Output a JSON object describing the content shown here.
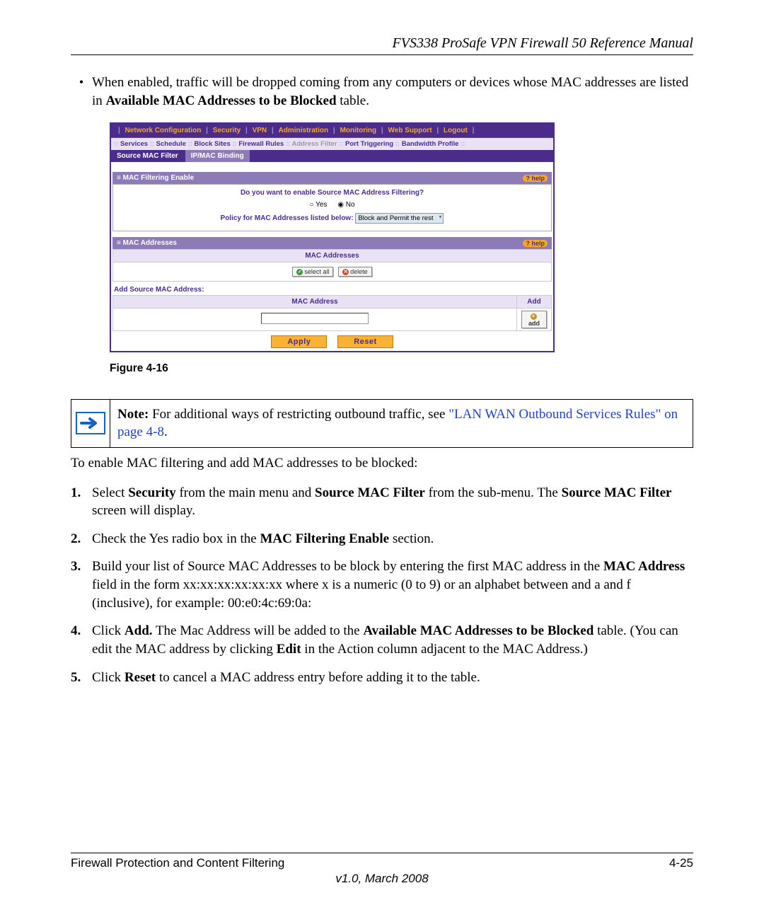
{
  "header": {
    "manual_title": "FVS338 ProSafe VPN Firewall 50 Reference Manual"
  },
  "bullet": {
    "text_prefix": "When enabled, traffic will be dropped coming from any computers or devices whose MAC addresses are listed in ",
    "bold": "Available MAC Addresses to be Blocked",
    "suffix": " table."
  },
  "figure": {
    "caption": "Figure 4-16"
  },
  "ui": {
    "topnav": [
      "Network Configuration",
      "Security",
      "VPN",
      "Administration",
      "Monitoring",
      "Web Support",
      "Logout"
    ],
    "subnav": [
      "Services",
      "Schedule",
      "Block Sites",
      "Firewall Rules",
      "Address Filter",
      "Port Triggering",
      "Bandwidth Profile"
    ],
    "subnav_selected_idx": 4,
    "tabs": {
      "active": "Source MAC Filter",
      "other": "IP/MAC Binding"
    },
    "section1": {
      "title": "MAC Filtering Enable",
      "help": "help",
      "question": "Do you want to enable Source MAC Address Filtering?",
      "radio_yes": "Yes",
      "radio_no": "No",
      "radio_selected": "No",
      "policy_label": "Policy for MAC Addresses listed below:",
      "policy_value": "Block and Permit the rest"
    },
    "section2": {
      "title": "MAC Addresses",
      "header": "MAC Addresses",
      "select_all": "select all",
      "delete": "delete",
      "add_src_label": "Add Source MAC Address:",
      "col_mac": "MAC Address",
      "col_add": "Add",
      "add_btn": "add"
    },
    "buttons": {
      "apply": "Apply",
      "reset": "Reset"
    }
  },
  "note": {
    "bold": "Note:",
    "text": " For additional ways of restricting outbound traffic, see ",
    "link": "\"LAN WAN Outbound Services Rules\" on page 4-8",
    "suffix": "."
  },
  "intro": "To enable MAC filtering and add MAC addresses to be blocked:",
  "steps": [
    {
      "n": "1.",
      "pre": "Select ",
      "b1": "Security",
      "mid1": " from the main menu and ",
      "b2": "Source MAC Filter",
      "mid2": " from the sub-menu. The ",
      "b3": "Source MAC Filter",
      "post": " screen will display."
    },
    {
      "n": "2.",
      "pre": "Check the Yes radio box in the ",
      "b1": "MAC Filtering Enable",
      "post": " section."
    },
    {
      "n": "3.",
      "pre": "Build your list of Source MAC Addresses to be block by entering the first MAC address in the ",
      "b1": "MAC Address",
      "post": " field in the form xx:xx:xx:xx:xx:xx where x is a numeric (0 to 9) or an alphabet between and a and f (inclusive), for example: 00:e0:4c:69:0a:"
    },
    {
      "n": "4.",
      "pre": "Click ",
      "b1": "Add.",
      "mid1": " The Mac Address will be added to the ",
      "b2": "Available MAC Addresses to be Blocked",
      "mid2": " table. (You can edit the MAC address by clicking ",
      "b3": "Edit",
      "post": " in the Action column adjacent to the MAC Address.)"
    },
    {
      "n": "5.",
      "pre": "Click ",
      "b1": "Reset",
      "post": " to cancel a MAC address entry before adding it to the table."
    }
  ],
  "footer": {
    "left": "Firewall Protection and Content Filtering",
    "right": "4-25",
    "version": "v1.0, March 2008"
  }
}
